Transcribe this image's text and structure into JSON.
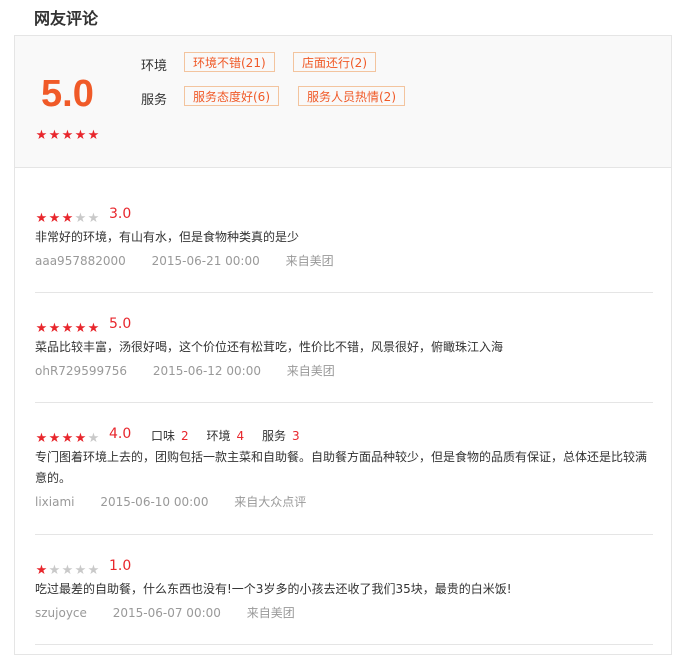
{
  "section_title": "网友评论",
  "summary": {
    "score": "5.0",
    "stars": 5,
    "groups": [
      {
        "label": "环境",
        "tags": [
          "环境不错(21)",
          "店面还行(2)"
        ]
      },
      {
        "label": "服务",
        "tags": [
          "服务态度好(6)",
          "服务人员热情(2)"
        ]
      }
    ]
  },
  "colors": {
    "accent": "#f05a28",
    "star_on": "#e8262c",
    "star_off": "#c9c9c9"
  },
  "reviews": [
    {
      "stars": 3,
      "score": "3.0",
      "text": "非常好的环境，有山有水，但是食物种类真的是少",
      "user": "aaa957882000",
      "time": "2015-06-21 00:00",
      "source": "来自美团"
    },
    {
      "stars": 5,
      "score": "5.0",
      "text": "菜品比较丰富，汤很好喝，这个价位还有松茸吃，性价比不错，风景很好，俯瞰珠江入海",
      "user": "ohR729599756",
      "time": "2015-06-12 00:00",
      "source": "来自美团"
    },
    {
      "stars": 4,
      "score": "4.0",
      "sub_scores": [
        {
          "label": "口味",
          "value": "2"
        },
        {
          "label": "环境",
          "value": "4"
        },
        {
          "label": "服务",
          "value": "3"
        }
      ],
      "text": "专门图着环境上去的，团购包括一款主菜和自助餐。自助餐方面品种较少，但是食物的品质有保证，总体还是比较满意的。",
      "user": "lixiami",
      "time": "2015-06-10 00:00",
      "source": "来自大众点评"
    },
    {
      "stars": 1,
      "score": "1.0",
      "text": "吃过最差的自助餐，什么东西也没有!一个3岁多的小孩去还收了我们35块，最贵的白米饭!",
      "user": "szujoyce",
      "time": "2015-06-07 00:00",
      "source": "来自美团"
    }
  ]
}
